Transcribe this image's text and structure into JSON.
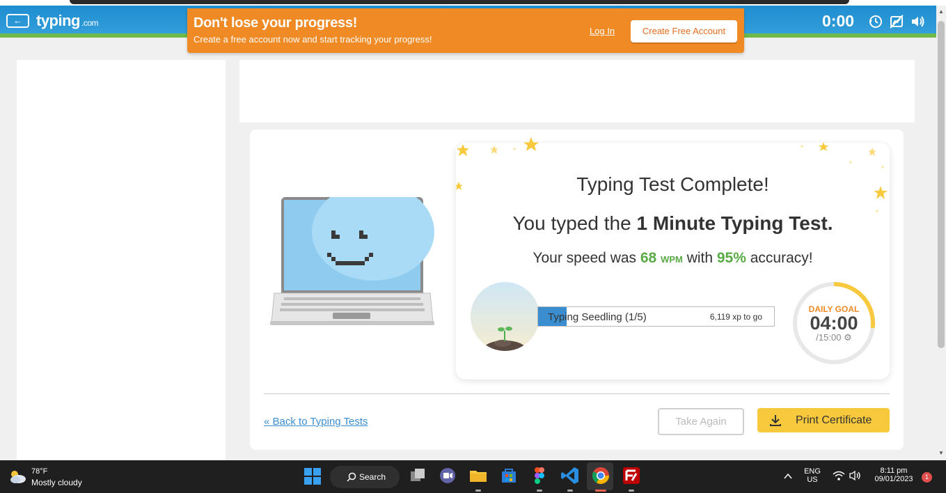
{
  "header": {
    "back_label": "←",
    "logo_text": "typing",
    "logo_suffix": ".com",
    "timer": "0:00"
  },
  "promo": {
    "title": "Don't lose your progress!",
    "subtitle": "Create a free account now and start tracking your progress!",
    "login_label": "Log In",
    "create_label": "Create Free Account"
  },
  "result": {
    "title": "Typing Test Complete!",
    "typed_prefix": "You typed the ",
    "typed_test": "1 Minute Typing Test.",
    "speed_prefix": "Your speed was ",
    "speed_value": "68",
    "speed_unit": "WPM",
    "speed_mid": " with ",
    "accuracy": "95%",
    "speed_suffix": " accuracy!"
  },
  "level": {
    "name": "Typing Seedling (1/5)",
    "xp_to_go": "6,119 xp to go",
    "progress_fraction": 0.12
  },
  "daily_goal": {
    "label": "DAILY GOAL",
    "time": "04:00",
    "total": "/15:00",
    "progress_fraction": 0.27
  },
  "actions": {
    "back_link": "« Back to Typing Tests",
    "take_again": "Take Again",
    "print_certificate": "Print Certificate"
  },
  "taskbar": {
    "weather_temp": "78°F",
    "weather_desc": "Mostly cloudy",
    "search_label": "Search",
    "lang_top": "ENG",
    "lang_bottom": "US",
    "time": "8:11 pm",
    "date": "09/01/2023",
    "notification_count": "1"
  },
  "colors": {
    "header_blue": "#2e9ad8",
    "promo_orange": "#f08a24",
    "accent_green": "#5aaa46",
    "xp_blue": "#3a8ecf",
    "cert_yellow": "#f8c93c"
  }
}
